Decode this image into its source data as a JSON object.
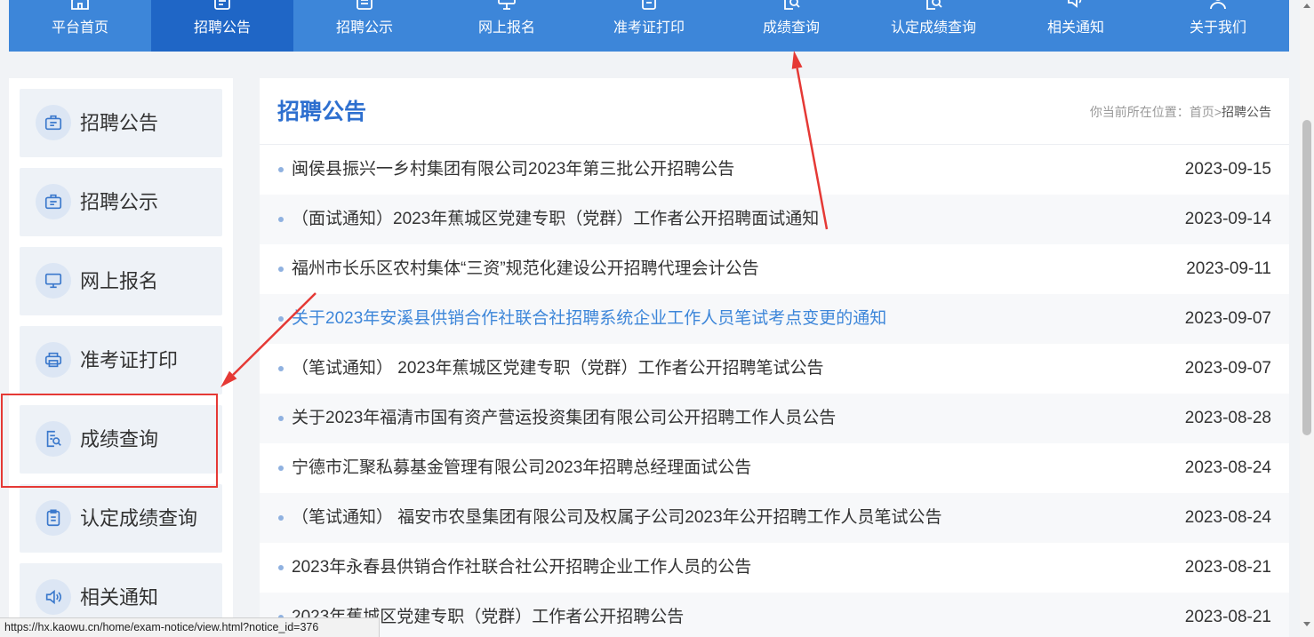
{
  "nav": {
    "items": [
      {
        "label": "平台首页",
        "icon": "home-icon",
        "active": false
      },
      {
        "label": "招聘公告",
        "icon": "notice-icon",
        "active": true
      },
      {
        "label": "招聘公示",
        "icon": "clipboard-icon",
        "active": false
      },
      {
        "label": "网上报名",
        "icon": "monitor-icon",
        "active": false
      },
      {
        "label": "准考证打印",
        "icon": "printer-icon",
        "active": false
      },
      {
        "label": "成绩查询",
        "icon": "score-search-icon",
        "active": false
      },
      {
        "label": "认定成绩查询",
        "icon": "certified-score-search-icon",
        "active": false
      },
      {
        "label": "相关通知",
        "icon": "speaker-icon",
        "active": false
      },
      {
        "label": "关于我们",
        "icon": "user-icon",
        "active": false
      }
    ]
  },
  "sidebar": {
    "items": [
      {
        "label": "招聘公告",
        "icon": "briefcase-icon",
        "highlighted": false
      },
      {
        "label": "招聘公示",
        "icon": "briefcase-icon",
        "highlighted": false
      },
      {
        "label": "网上报名",
        "icon": "monitor-icon",
        "highlighted": false
      },
      {
        "label": "准考证打印",
        "icon": "printer-icon",
        "highlighted": false
      },
      {
        "label": "成绩查询",
        "icon": "score-search-icon",
        "highlighted": true
      },
      {
        "label": "认定成绩查询",
        "icon": "clipboard-icon",
        "highlighted": false
      },
      {
        "label": "相关通知",
        "icon": "speaker-icon",
        "highlighted": false
      }
    ]
  },
  "main": {
    "title": "招聘公告",
    "breadcrumb": {
      "prefix": "你当前所在位置：",
      "home": "首页",
      "separator": ">",
      "current": "招聘公告"
    },
    "rows": [
      {
        "title": "闽侯县振兴一乡村集团有限公司2023年第三批公开招聘公告",
        "date": "2023-09-15",
        "hover": false
      },
      {
        "title": "（面试通知）2023年蕉城区党建专职（党群）工作者公开招聘面试通知",
        "date": "2023-09-14",
        "hover": false
      },
      {
        "title": "福州市长乐区农村集体“三资”规范化建设公开招聘代理会计公告",
        "date": "2023-09-11",
        "hover": false
      },
      {
        "title": "关于2023年安溪县供销合作社联合社招聘系统企业工作人员笔试考点变更的通知",
        "date": "2023-09-07",
        "hover": true
      },
      {
        "title": "（笔试通知） 2023年蕉城区党建专职（党群）工作者公开招聘笔试公告",
        "date": "2023-09-07",
        "hover": false
      },
      {
        "title": "关于2023年福清市国有资产营运投资集团有限公司公开招聘工作人员公告",
        "date": "2023-08-28",
        "hover": false
      },
      {
        "title": "宁德市汇聚私募基金管理有限公司2023年招聘总经理面试公告",
        "date": "2023-08-24",
        "hover": false
      },
      {
        "title": "（笔试通知） 福安市农垦集团有限公司及权属子公司2023年公开招聘工作人员笔试公告",
        "date": "2023-08-24",
        "hover": false
      },
      {
        "title": "2023年永春县供销合作社联合社公开招聘企业工作人员的公告",
        "date": "2023-08-21",
        "hover": false
      },
      {
        "title": "2023年蕉城区党建专职（党群）工作者公开招聘公告",
        "date": "2023-08-21",
        "hover": false
      }
    ]
  },
  "status_bar": {
    "url": "https://hx.kaowu.cn/home/exam-notice/view.html?notice_id=376"
  },
  "colors": {
    "nav_bg": "#3d86d9",
    "nav_active": "#1f66c6",
    "title_accent": "#2d6fcf",
    "link_hover": "#3d86d9",
    "page_bg": "#f1f3f6",
    "annotation": "#e53935"
  }
}
